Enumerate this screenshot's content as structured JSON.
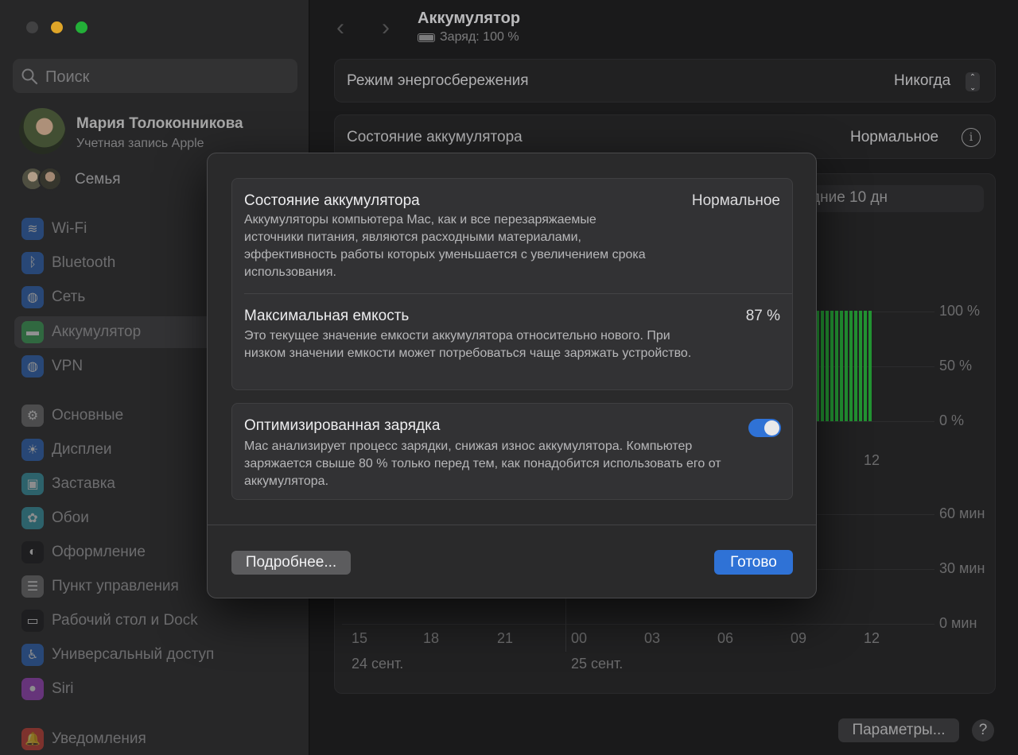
{
  "window": {
    "traffic_lights": {
      "close_color": "#4a4a4c",
      "minimize_color": "#febc2e",
      "zoom_color": "#28c840"
    }
  },
  "sidebar": {
    "search_placeholder": "Поиск",
    "user": {
      "name": "Мария Толоконникова",
      "subtitle": "Учетная запись Apple"
    },
    "family_label": "Семья",
    "items": [
      {
        "label": "Wi-Fi",
        "icon": "wifi-icon",
        "color": "#2f6fd0"
      },
      {
        "label": "Bluetooth",
        "icon": "bluetooth-icon",
        "color": "#2f6fd0"
      },
      {
        "label": "Сеть",
        "icon": "globe-icon",
        "color": "#2f6fd0"
      },
      {
        "label": "Аккумулятор",
        "icon": "battery-icon",
        "color": "#34a853",
        "selected": true
      },
      {
        "label": "VPN",
        "icon": "vpn-globe-icon",
        "color": "#2f6fd0"
      },
      {
        "label": "Основные",
        "icon": "gear-icon",
        "color": "#7a7a7c"
      },
      {
        "label": "Дисплеи",
        "icon": "sun-icon",
        "color": "#2f6fd0"
      },
      {
        "label": "Заставка",
        "icon": "screensaver-icon",
        "color": "#3aa7b8"
      },
      {
        "label": "Обои",
        "icon": "flower-icon",
        "color": "#3aa7b8"
      },
      {
        "label": "Оформление",
        "icon": "appearance-icon",
        "color": "#1c1c1e"
      },
      {
        "label": "Пункт управления",
        "icon": "control-center-icon",
        "color": "#7a7a7c"
      },
      {
        "label": "Рабочий стол и Dock",
        "icon": "dock-icon",
        "color": "#1c1c1e"
      },
      {
        "label": "Универсальный доступ",
        "icon": "accessibility-icon",
        "color": "#2f6fd0"
      },
      {
        "label": "Siri",
        "icon": "siri-icon",
        "color": "#b04ad8"
      },
      {
        "label": "Уведомления",
        "icon": "bell-icon",
        "color": "#e0443a"
      }
    ]
  },
  "main": {
    "title": "Аккумулятор",
    "subtitle": "Заряд: 100 %",
    "low_power": {
      "label": "Режим энергосбережения",
      "value": "Никогда"
    },
    "battery_health": {
      "label": "Состояние аккумулятора",
      "value": "Нормальное"
    },
    "range_label": "дние 10 дн",
    "chart": {
      "level_ticks": [
        "100 %",
        "50 %",
        "0 %"
      ],
      "level_x_tick": "12",
      "usage_ticks": [
        "60 мин",
        "30 мин",
        "0 мин"
      ],
      "hour_ticks": [
        "15",
        "18",
        "21",
        "00",
        "03",
        "06",
        "09",
        "12"
      ],
      "dates": [
        "24 сент.",
        "25 сент."
      ],
      "level_bars_percent": [
        100,
        100,
        100,
        100,
        100,
        100,
        100,
        100,
        100,
        100,
        100,
        100
      ],
      "bar_color": "#27a83a"
    },
    "options_button": "Параметры...",
    "help_button": "?"
  },
  "modal": {
    "health": {
      "title": "Состояние аккумулятора",
      "value": "Нормальное",
      "description": "Аккумуляторы компьютера Mac, как и все перезаряжаемые источники питания, являются расходными материалами, эффективность работы которых уменьшается с увеличением срока использования."
    },
    "capacity": {
      "title": "Максимальная емкость",
      "value": "87 %",
      "description": "Это текущее значение емкости аккумулятора относительно нового. При низком значении емкости может потребоваться чаще заряжать устройство."
    },
    "optimized": {
      "title": "Оптимизированная зарядка",
      "enabled": true,
      "description": "Mac анализирует процесс зарядки, снижая износ аккумулятора. Компьютер заряжается свыше 80 % только перед тем, как понадобится использовать его от аккумулятора."
    },
    "more_button": "Подробнее...",
    "done_button": "Готово"
  }
}
